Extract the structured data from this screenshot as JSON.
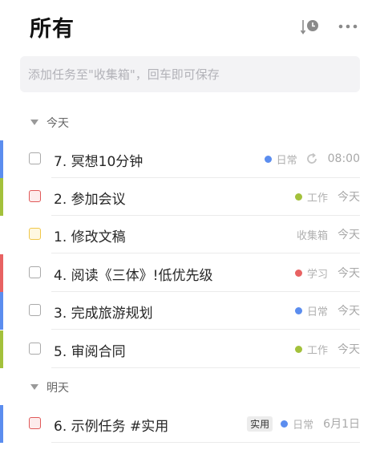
{
  "header": {
    "title": "所有",
    "sort_icon": "sort-by-time-icon",
    "more_icon": "more-horizontal-icon"
  },
  "add_task": {
    "placeholder": "添加任务至\"收集箱\"，回车即可保存"
  },
  "sections": [
    {
      "label": "今天",
      "tasks": [
        {
          "title": "7. 冥想10分钟",
          "checkbox": "default",
          "bar_color": "#5b8def",
          "list": "日常",
          "list_color": "#5b8def",
          "repeat": true,
          "date": "08:00"
        },
        {
          "title": "2. 参加会议",
          "checkbox": "red",
          "bar_color": "#a3c13b",
          "list": "工作",
          "list_color": "#a3c13b",
          "date": "今天"
        },
        {
          "title": "1. 修改文稿",
          "checkbox": "yellow",
          "bar_color": "",
          "list": "收集箱",
          "list_color": "",
          "date": "今天"
        },
        {
          "title": "4. 阅读《三体》!低优先级",
          "checkbox": "default",
          "bar_color": "#e86262",
          "list": "学习",
          "list_color": "#e86262",
          "date": "今天"
        },
        {
          "title": "3. 完成旅游规划",
          "checkbox": "default",
          "bar_color": "#5b8def",
          "list": "日常",
          "list_color": "#5b8def",
          "date": "今天"
        },
        {
          "title": "5. 审阅合同",
          "checkbox": "default",
          "bar_color": "#a3c13b",
          "list": "工作",
          "list_color": "#a3c13b",
          "date": "今天"
        }
      ]
    },
    {
      "label": "明天",
      "tasks": [
        {
          "title": "6.  示例任务 #实用",
          "checkbox": "red",
          "bar_color": "#5b8def",
          "tag": "实用",
          "list": "日常",
          "list_color": "#5b8def",
          "date": "6月1日"
        }
      ]
    }
  ]
}
